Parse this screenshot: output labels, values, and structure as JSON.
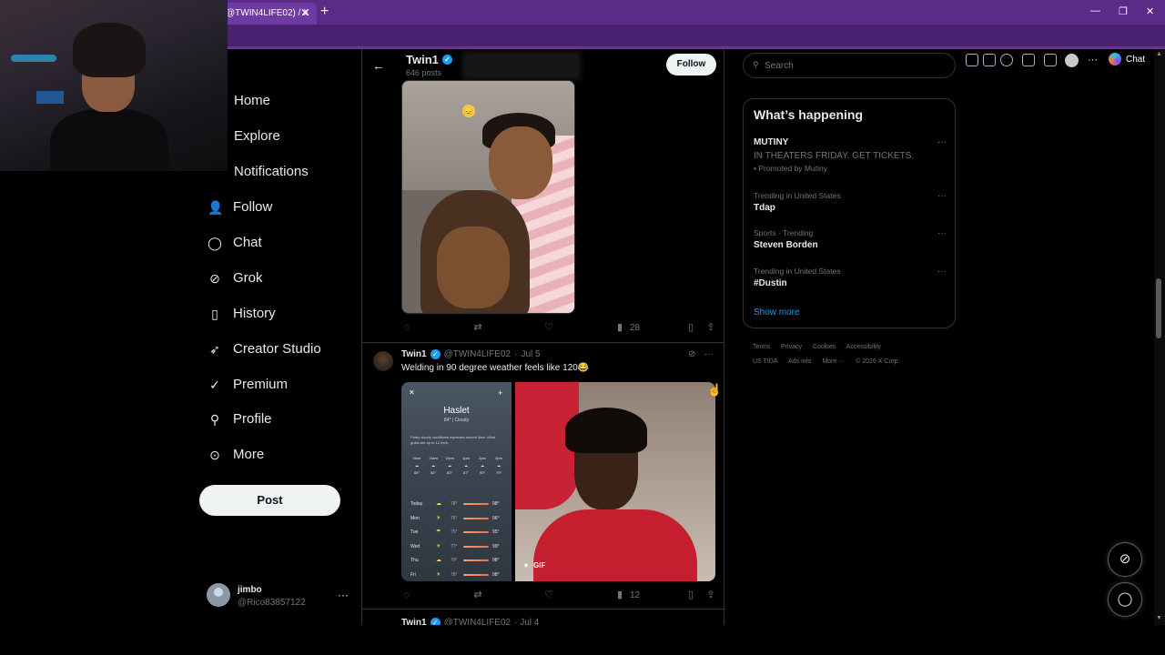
{
  "browser": {
    "tab_title": "@TWIN4LIFE02) / X",
    "tab_close": "✕",
    "new_tab": "+",
    "minimize": "—",
    "restore": "❐",
    "close": "✕",
    "more_menu": "···",
    "chat_label": "Chat"
  },
  "nav": {
    "items": [
      {
        "label": "Home",
        "icon": "home-icon"
      },
      {
        "label": "Explore",
        "icon": "search-icon"
      },
      {
        "label": "Notifications",
        "icon": "bell-icon"
      },
      {
        "label": "Follow",
        "icon": "person-add-icon"
      },
      {
        "label": "Chat",
        "icon": "chat-icon"
      },
      {
        "label": "Grok",
        "icon": "grok-icon"
      },
      {
        "label": "History",
        "icon": "bookmark-icon"
      },
      {
        "label": "Creator Studio",
        "icon": "rocket-icon"
      },
      {
        "label": "Premium",
        "icon": "verified-icon"
      },
      {
        "label": "Profile",
        "icon": "person-icon"
      },
      {
        "label": "More",
        "icon": "more-circle-icon"
      }
    ],
    "post_label": "Post",
    "account": {
      "name": "jimbo",
      "handle": "@Rico83857122",
      "more": "···"
    }
  },
  "feed": {
    "header": {
      "name": "Twin1",
      "posts": "646 posts",
      "follow_label": "Follow"
    },
    "tweet1_actions": {
      "views": "28"
    },
    "tweet2": {
      "name": "Twin1",
      "handle": "@TWIN4LIFE02",
      "sep": "·",
      "date": "Jul 5",
      "text": "Welding in 90 degree weather feels like 120😂",
      "views": "12",
      "more": "···"
    },
    "weather": {
      "city": "Haslet",
      "sub": "84° | Cloudy",
      "desc": "Partly cloudy conditions expected around 3am. Wind gusts are up to 12 mph.",
      "hours": [
        "Now",
        "11am",
        "12pm",
        "1pm",
        "2pm",
        "3pm"
      ],
      "hour_temps": [
        "84°",
        "84°",
        "83°",
        "87°",
        "90°",
        "79°"
      ],
      "days": [
        {
          "d": "Today",
          "lo": "78°",
          "hi": "98°"
        },
        {
          "d": "Mon",
          "lo": "76°",
          "hi": "96°"
        },
        {
          "d": "Tue",
          "lo": "75°",
          "hi": "95°"
        },
        {
          "d": "Wed",
          "lo": "77°",
          "hi": "99°"
        },
        {
          "d": "Thu",
          "lo": "79°",
          "hi": "98°"
        },
        {
          "d": "Fri",
          "lo": "78°",
          "hi": "98°"
        }
      ]
    },
    "gif_label": "GIF",
    "tweet3": {
      "name": "Twin1",
      "handle": "@TWIN4LIFE02",
      "date": "· Jul 4"
    }
  },
  "sidebar": {
    "search_placeholder": "Search",
    "happening_title": "What’s happening",
    "trends": [
      {
        "ctx": "IN THEATERS FRIDAY. GET TICKETS.",
        "name": "MUTINY",
        "promo": "Promoted by Mutiny"
      },
      {
        "ctx": "Trending in United States",
        "name": "Tdap"
      },
      {
        "ctx": "Sports · Trending",
        "name": "Steven Borden"
      },
      {
        "ctx": "Trending in United States",
        "name": "#Dustin"
      }
    ],
    "show_more": "Show more",
    "footer": [
      "Terms",
      "Privacy",
      "Cookies",
      "Accessibility",
      "US TIDA",
      "Ads info",
      "More ···",
      "© 2026 X Corp."
    ]
  },
  "colors": {
    "accent": "#1d9bf0",
    "browser_frame": "#5b2b86",
    "background": "#000000"
  }
}
